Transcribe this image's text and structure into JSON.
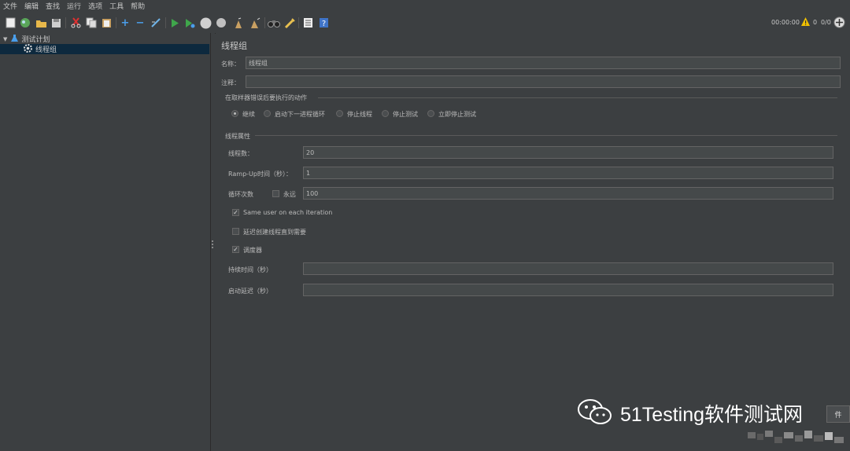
{
  "menu": [
    "文件",
    "编辑",
    "查找",
    "运行",
    "选项",
    "工具",
    "帮助"
  ],
  "toolbar": {
    "timer": "00:00:00",
    "warn_count": "0",
    "thread_ratio": "0/0"
  },
  "tree": {
    "root_label": "测试计划",
    "child_label": "线程组"
  },
  "panel": {
    "title": "线程组",
    "name_label": "名称：",
    "name_value": "线程组",
    "comment_label": "注释：",
    "comment_value": "",
    "error_section_title": "在取样器错误后要执行的动作",
    "error_options": [
      "继续",
      "启动下一进程循环",
      "停止线程",
      "停止测试",
      "立即停止测试"
    ],
    "error_selected": "继续",
    "thread_props_title": "线程属性",
    "threads_label": "线程数：",
    "threads_value": "20",
    "rampup_label": "Ramp-Up时间（秒）：",
    "rampup_value": "1",
    "loop_label": "循环次数",
    "forever_label": "永远",
    "loop_value": "100",
    "same_user_label": "Same user on each iteration",
    "delay_create_label": "延迟创建线程直到需要",
    "scheduler_label": "调度器",
    "duration_label": "持续时间（秒）",
    "duration_value": "",
    "startup_delay_label": "启动延迟（秒）",
    "startup_delay_value": ""
  },
  "watermark": {
    "text": "51Testing软件测试网",
    "corner_tab": "件"
  }
}
